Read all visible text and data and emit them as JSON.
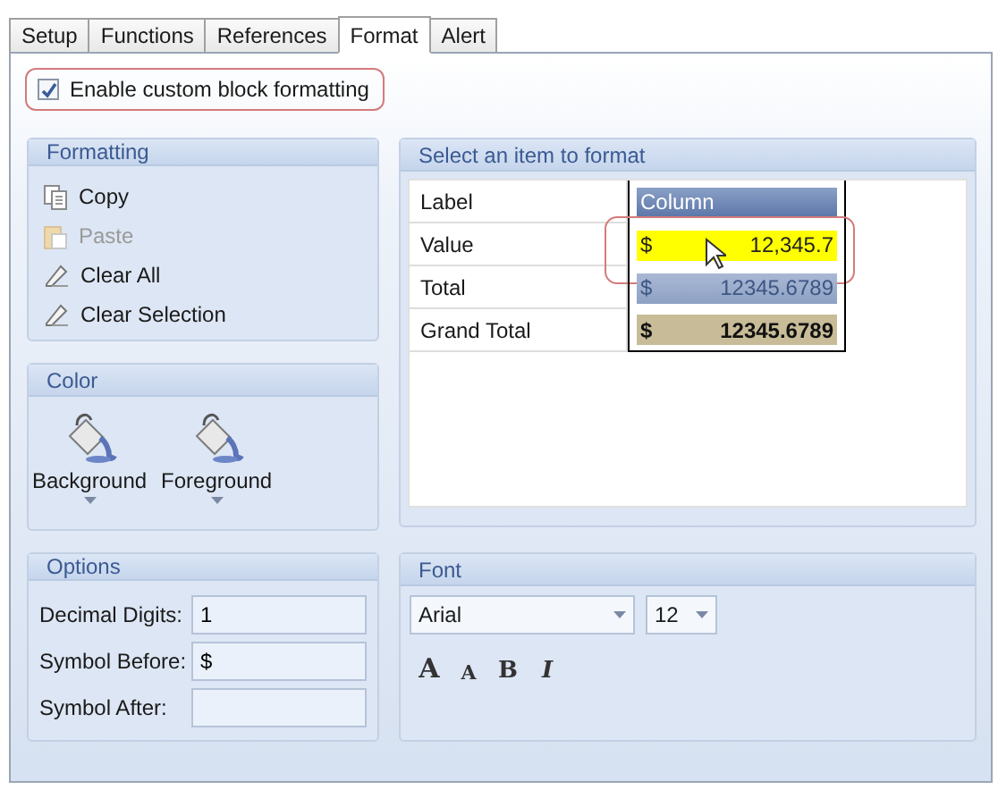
{
  "tabs": [
    {
      "label": "Setup",
      "selected": false
    },
    {
      "label": "Functions",
      "selected": false
    },
    {
      "label": "References",
      "selected": false
    },
    {
      "label": "Format",
      "selected": true
    },
    {
      "label": "Alert",
      "selected": false
    }
  ],
  "enable_checkbox": {
    "label": "Enable custom block formatting",
    "checked": true
  },
  "formatting": {
    "title": "Formatting",
    "items": [
      {
        "label": "Copy",
        "kind": "copy",
        "disabled": false
      },
      {
        "label": "Paste",
        "kind": "paste",
        "disabled": true
      },
      {
        "label": "Clear All",
        "kind": "eraser",
        "disabled": false
      },
      {
        "label": "Clear Selection",
        "kind": "eraser",
        "disabled": false
      }
    ]
  },
  "color": {
    "title": "Color",
    "buttons": [
      {
        "label": "Background"
      },
      {
        "label": "Foreground"
      }
    ]
  },
  "select_item": {
    "title": "Select an item to format",
    "rows": [
      {
        "label": "Label",
        "kind": "header",
        "text": "Column",
        "selected": false
      },
      {
        "label": "Value",
        "kind": "value",
        "symbol": "$",
        "text": "12,345.7",
        "selected": true
      },
      {
        "label": "Total",
        "kind": "total",
        "symbol": "$",
        "text": "12345.6789",
        "selected": false
      },
      {
        "label": "Grand Total",
        "kind": "grand",
        "symbol": "$",
        "text": "12345.6789",
        "selected": false
      }
    ]
  },
  "options": {
    "title": "Options",
    "fields": [
      {
        "label": "Decimal Digits:",
        "value": "1"
      },
      {
        "label": "Symbol Before:",
        "value": "$"
      },
      {
        "label": "Symbol After:"
      }
    ]
  },
  "font": {
    "title": "Font",
    "family": "Arial",
    "size": "12",
    "buttons": [
      {
        "label": "A",
        "kind": "grow"
      },
      {
        "label": "A",
        "kind": "shrink"
      },
      {
        "label": "B",
        "kind": "bold"
      },
      {
        "label": "I",
        "kind": "italic"
      }
    ]
  }
}
